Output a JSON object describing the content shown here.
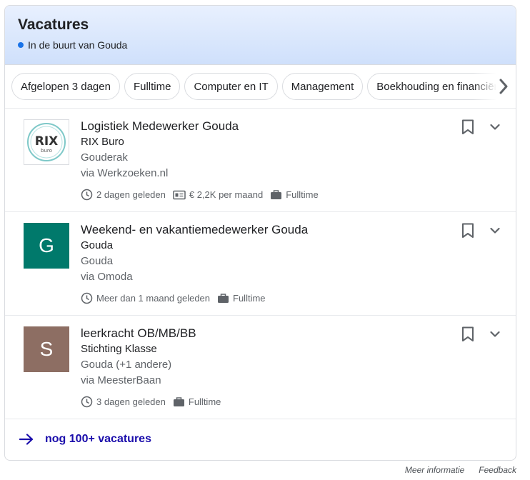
{
  "header": {
    "title": "Vacatures",
    "subtitle": "In de buurt van Gouda",
    "accent": "#1a73e8"
  },
  "chips": [
    {
      "label": "Afgelopen 3 dagen"
    },
    {
      "label": "Fulltime"
    },
    {
      "label": "Computer en IT"
    },
    {
      "label": "Management"
    },
    {
      "label": "Boekhouding en financiën"
    }
  ],
  "jobs": [
    {
      "title": "Logistiek Medewerker Gouda",
      "company": "RIX Buro",
      "location": "Gouderak",
      "via": "via Werkzoeken.nl",
      "logo_text": "RIX",
      "logo_sub": "buro",
      "posted": "2 dagen geleden",
      "salary": "€ 2,2K per maand",
      "type": "Fulltime"
    },
    {
      "title": "Weekend- en vakantiemedewerker Gouda",
      "company": "Gouda",
      "location": "Gouda",
      "via": "via Omoda",
      "logo_text": "G",
      "logo_color": "#00796b",
      "posted": "Meer dan 1 maand geleden",
      "type": "Fulltime"
    },
    {
      "title": "leerkracht OB/MB/BB",
      "company": "Stichting Klasse",
      "location": "Gouda (+1 andere)",
      "via": "via MeesterBaan",
      "logo_text": "S",
      "logo_color": "#8d6e63",
      "posted": "3 dagen geleden",
      "type": "Fulltime"
    }
  ],
  "more": {
    "label": "nog 100+ vacatures",
    "icon": "arrow-right-icon"
  },
  "footer": {
    "info": "Meer informatie",
    "feedback": "Feedback"
  }
}
